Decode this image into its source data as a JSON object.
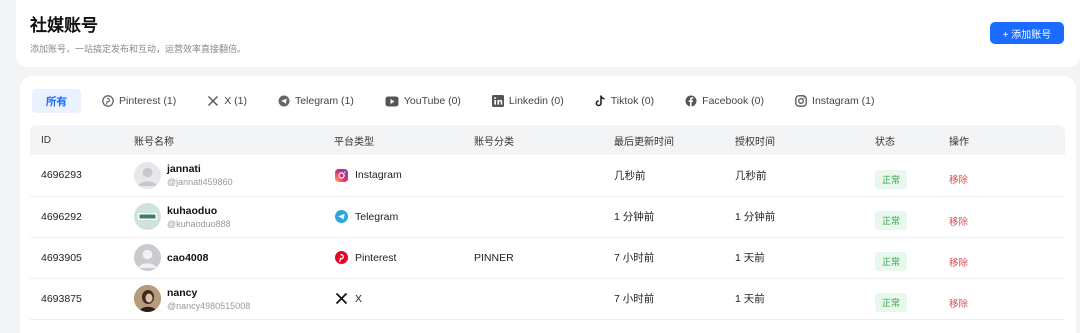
{
  "header": {
    "title": "社媒账号",
    "subtitle": "添加账号，一站搞定发布和互动，运营效率直接翻倍。",
    "add_button": "+ 添加账号"
  },
  "tabs": [
    {
      "label": "所有",
      "icon": "none"
    },
    {
      "label": "Pinterest (1)",
      "icon": "pinterest-icon"
    },
    {
      "label": "X (1)",
      "icon": "x-icon"
    },
    {
      "label": "Telegram (1)",
      "icon": "telegram-icon"
    },
    {
      "label": "YouTube (0)",
      "icon": "youtube-icon"
    },
    {
      "label": "Linkedin (0)",
      "icon": "linkedin-icon"
    },
    {
      "label": "Tiktok (0)",
      "icon": "tiktok-icon"
    },
    {
      "label": "Facebook (0)",
      "icon": "facebook-icon"
    },
    {
      "label": "Instagram (1)",
      "icon": "instagram-icon"
    }
  ],
  "table": {
    "columns": [
      "ID",
      "账号名称",
      "平台类型",
      "账号分类",
      "最后更新时间",
      "授权时间",
      "状态",
      "操作"
    ],
    "rows": [
      {
        "id": "4696293",
        "name": "jannati",
        "handle": "@jannati459860",
        "platform": "Instagram",
        "category": "",
        "updated": "几秒前",
        "authorized": "几秒前",
        "status": "正常",
        "action": "移除"
      },
      {
        "id": "4696292",
        "name": "kuhaoduo",
        "handle": "@kuhaoduo888",
        "platform": "Telegram",
        "category": "",
        "updated": "1 分钟前",
        "authorized": "1 分钟前",
        "status": "正常",
        "action": "移除"
      },
      {
        "id": "4693905",
        "name": "cao4008",
        "handle": "",
        "platform": "Pinterest",
        "category": "PINNER",
        "updated": "7 小时前",
        "authorized": "1 天前",
        "status": "正常",
        "action": "移除"
      },
      {
        "id": "4693875",
        "name": "nancy",
        "handle": "@nancy4980515008",
        "platform": "X",
        "category": "",
        "updated": "7 小时前",
        "authorized": "1 天前",
        "status": "正常",
        "action": "移除"
      }
    ]
  },
  "colors": {
    "accent": "#1a6bff",
    "status_ok": "#2ea84a",
    "remove": "#e5484d"
  }
}
